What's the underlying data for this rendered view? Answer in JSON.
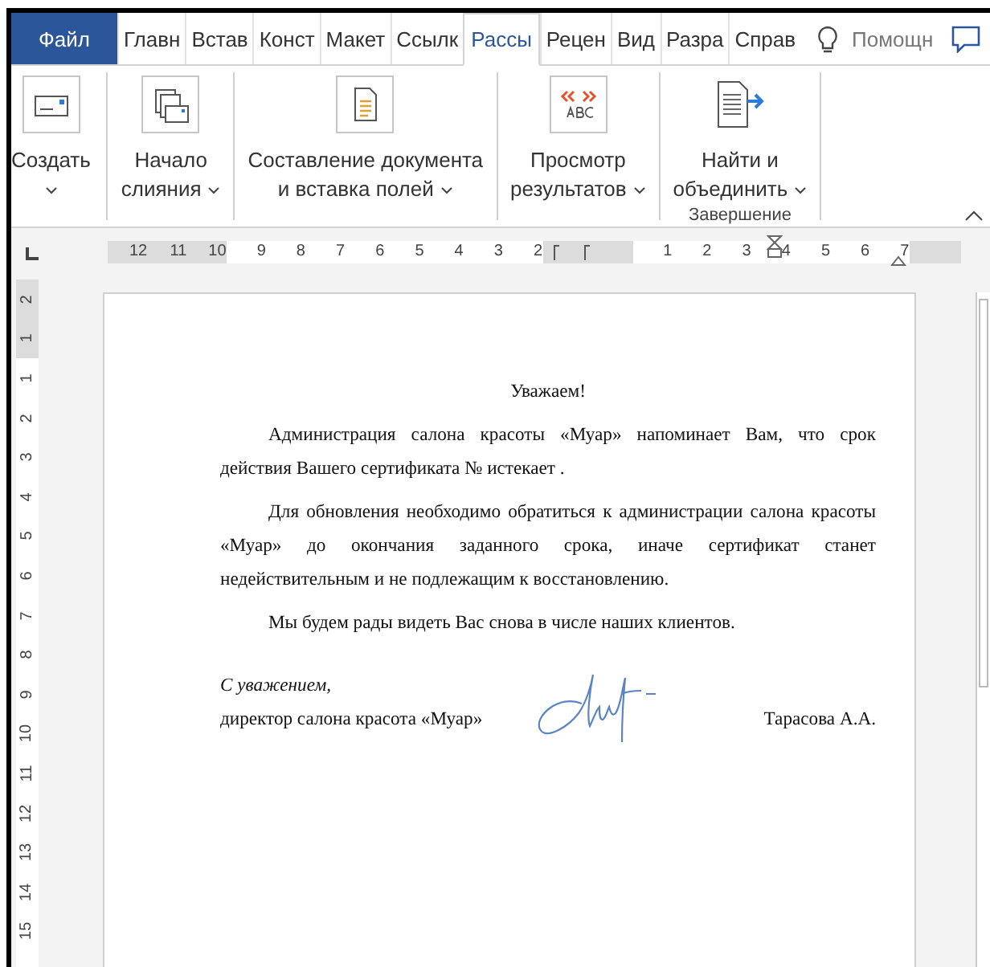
{
  "tabs": [
    {
      "label": "Файл",
      "kind": "file",
      "selected": false
    },
    {
      "label": "Главн",
      "kind": "tab",
      "selected": false
    },
    {
      "label": "Встав",
      "kind": "tab",
      "selected": false
    },
    {
      "label": "Конст",
      "kind": "tab",
      "selected": false
    },
    {
      "label": "Макет",
      "kind": "tab",
      "selected": false
    },
    {
      "label": "Ссылк",
      "kind": "tab",
      "selected": false
    },
    {
      "label": "Рассы",
      "kind": "tab",
      "selected": true
    },
    {
      "label": "Рецен",
      "kind": "tab",
      "selected": false
    },
    {
      "label": "Вид",
      "kind": "tab",
      "selected": false
    },
    {
      "label": "Разра",
      "kind": "tab",
      "selected": false
    },
    {
      "label": "Справ",
      "kind": "tab",
      "selected": false
    }
  ],
  "tell_me": {
    "placeholder": "Помощн"
  },
  "ribbon": {
    "groups": [
      {
        "buttons": [
          {
            "lines": [
              "Создать"
            ],
            "caret": true
          }
        ]
      },
      {
        "buttons": [
          {
            "lines": [
              "Начало",
              "слияния"
            ],
            "caret": true
          }
        ]
      },
      {
        "buttons": [
          {
            "lines": [
              "Составление документа",
              "и вставка полей"
            ],
            "caret": true
          }
        ]
      },
      {
        "buttons": [
          {
            "lines": [
              "Просмотр",
              "результатов"
            ],
            "caret": true
          }
        ]
      },
      {
        "label": "Завершение",
        "buttons": [
          {
            "lines": [
              "Найти и",
              "объединить"
            ],
            "caret": true
          }
        ]
      }
    ]
  },
  "ruler": {
    "numbers": [
      {
        "label": "12",
        "shaded": true
      },
      {
        "label": "11",
        "shaded": true
      },
      {
        "label": "10",
        "shaded": true
      },
      {
        "label": "9",
        "shaded": false
      },
      {
        "label": "8",
        "shaded": false
      },
      {
        "label": "7",
        "shaded": false
      },
      {
        "label": "6",
        "shaded": false
      },
      {
        "label": "5",
        "shaded": false
      },
      {
        "label": "4",
        "shaded": false
      },
      {
        "label": "3",
        "shaded": false
      },
      {
        "label": "2",
        "shaded": false
      },
      {
        "label": "1",
        "shaded": false
      },
      {
        "label": "2",
        "shaded": false
      },
      {
        "label": "3",
        "shaded": false
      },
      {
        "label": "4",
        "shaded": false
      },
      {
        "label": "5",
        "shaded": false
      },
      {
        "label": "6",
        "shaded": false
      },
      {
        "label": "7",
        "shaded": false
      }
    ]
  },
  "vertical_ruler": {
    "numbers": [
      {
        "label": "2",
        "shaded": true
      },
      {
        "label": "1",
        "shaded": true
      },
      {
        "label": "1",
        "shaded": false
      },
      {
        "label": "2",
        "shaded": false
      },
      {
        "label": "3",
        "shaded": false
      },
      {
        "label": "4",
        "shaded": false
      },
      {
        "label": "5",
        "shaded": false
      },
      {
        "label": "6",
        "shaded": false
      },
      {
        "label": "7",
        "shaded": false
      },
      {
        "label": "8",
        "shaded": false
      },
      {
        "label": "9",
        "shaded": false
      },
      {
        "label": "10",
        "shaded": false
      },
      {
        "label": "11",
        "shaded": false
      },
      {
        "label": "12",
        "shaded": false
      },
      {
        "label": "13",
        "shaded": false
      },
      {
        "label": "14",
        "shaded": false
      },
      {
        "label": "15",
        "shaded": false
      }
    ]
  },
  "document": {
    "greeting": "Уважаем!",
    "paragraphs": [
      "Администрация салона красоты «Муар» напоминает Вам, что срок действия Вашего сертификата №  истекает .",
      "Для обновления необходимо обратиться к администрации салона красоты «Муар» до окончания заданного срока, иначе сертификат станет недействительным и не подлежащим к восстановлению.",
      "Мы будем рады видеть Вас снова в числе наших клиентов."
    ],
    "closing": "С уважением,",
    "signer_title": "директор салона красота «Муар»",
    "signer_name": "Тарасова А.А."
  }
}
